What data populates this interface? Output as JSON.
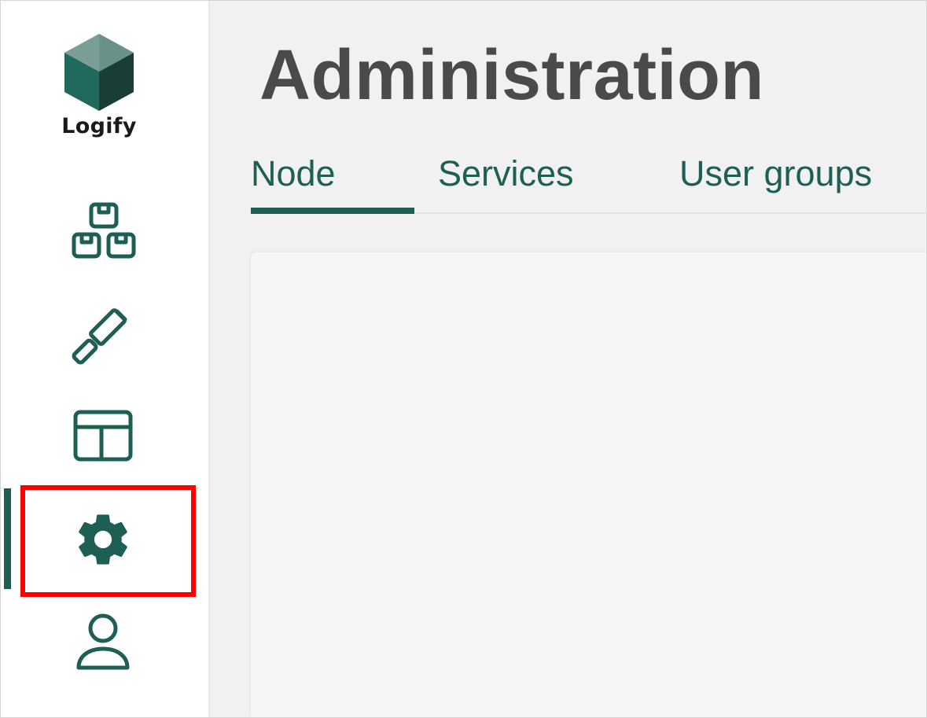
{
  "app": {
    "logo_text": "Logify",
    "accent_color": "#1d5f55",
    "highlight_color": "#ff0000"
  },
  "sidebar": {
    "items": [
      {
        "id": "apps",
        "icon": "boxes-icon",
        "active": false
      },
      {
        "id": "build",
        "icon": "hammer-icon",
        "active": false
      },
      {
        "id": "layout",
        "icon": "layout-icon",
        "active": false
      },
      {
        "id": "administration",
        "icon": "gear-icon",
        "active": true
      },
      {
        "id": "profile",
        "icon": "user-icon",
        "active": false
      }
    ]
  },
  "main": {
    "title": "Administration",
    "tabs": [
      {
        "label": "Node",
        "active": true
      },
      {
        "label": "Services",
        "active": false
      },
      {
        "label": "User groups",
        "active": false
      }
    ]
  }
}
